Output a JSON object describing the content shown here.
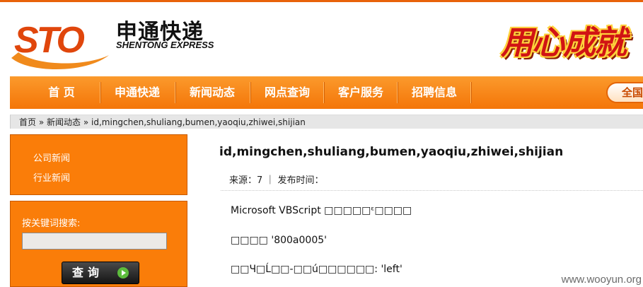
{
  "header": {
    "logo_mark": "STO",
    "logo_cn": "申通快递",
    "logo_en": "SHENTONG EXPRESS",
    "slogan": "用心成就"
  },
  "nav": {
    "items": [
      {
        "label": "首 页"
      },
      {
        "label": "申通快递"
      },
      {
        "label": "新闻动态"
      },
      {
        "label": "网点查询"
      },
      {
        "label": "客户服务"
      },
      {
        "label": "招聘信息"
      }
    ],
    "right_pill": "全国"
  },
  "breadcrumb": {
    "home": "首页",
    "sep1": "»",
    "section": "新闻动态",
    "sep2": "»",
    "current": "id,mingchen,shuliang,bumen,yaoqiu,zhiwei,shijian"
  },
  "sidebar": {
    "links": [
      {
        "label": "公司新闻"
      },
      {
        "label": "行业新闻"
      }
    ],
    "search": {
      "label": "按关键词搜索:",
      "value": "",
      "button": "查询"
    }
  },
  "article": {
    "title": "id,mingchen,shuliang,bumen,yaoqiu,zhiwei,shijian",
    "meta": "来源：7 ｜ 发布时间：",
    "lines": [
      "Microsoft VBScript □□□□□ᵋ□□□□",
      "□□□□ '800a0005'",
      "□□Ч□Ĺ□□-□□ú□□□□□□: 'left'"
    ]
  },
  "watermark": "www.wooyun.org",
  "colors": {
    "brand_orange": "#f47508",
    "logo_red": "#e0460c",
    "slogan_red": "#d11414"
  }
}
